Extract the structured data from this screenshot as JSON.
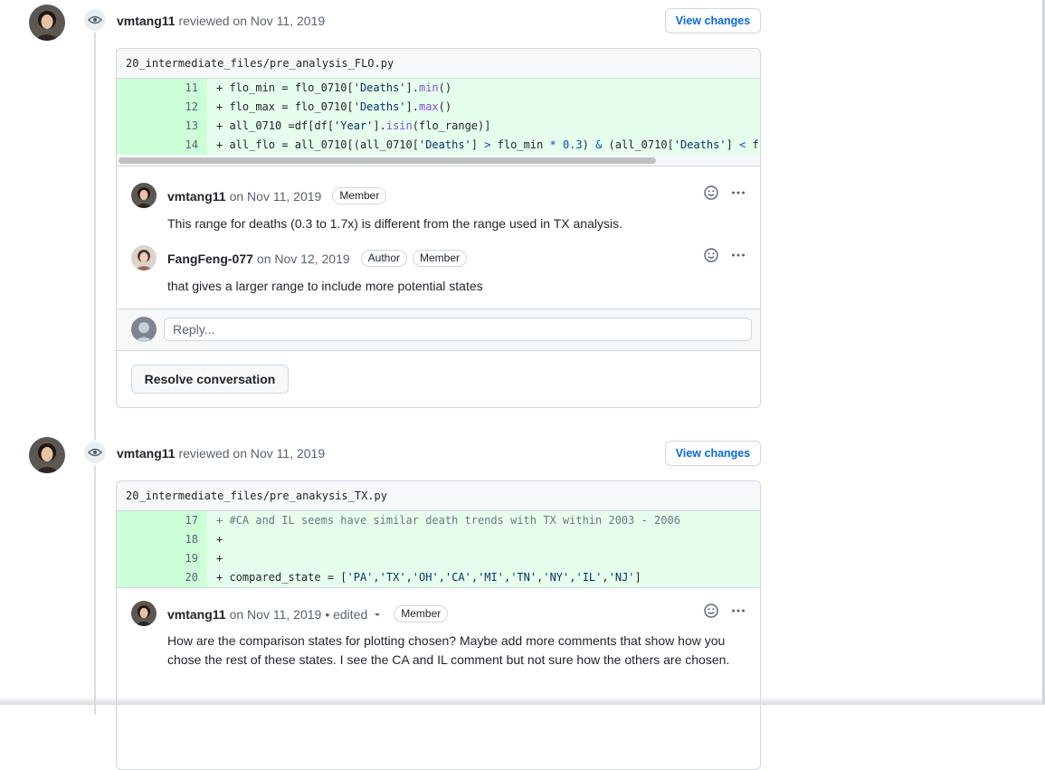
{
  "reviews": [
    {
      "author": "vmtang11",
      "verb": "reviewed",
      "date": "on Nov 11, 2019",
      "view_changes": "View changes",
      "file": "20_intermediate_files/pre_analysis_FLO.py",
      "lines": [
        {
          "num": "11"
        },
        {
          "num": "12"
        },
        {
          "num": "13"
        },
        {
          "num": "14"
        }
      ],
      "comments": [
        {
          "author": "vmtang11",
          "date": "on Nov 11, 2019",
          "labels": [
            "Member"
          ],
          "body": "This range for deaths (0.3 to 1.7x) is different from the range used in TX analysis."
        },
        {
          "author": "FangFeng-077",
          "date": "on Nov 12, 2019",
          "labels": [
            "Author",
            "Member"
          ],
          "body": "that gives a larger range to include more potential states"
        }
      ],
      "reply_placeholder": "Reply...",
      "resolve_label": "Resolve conversation"
    },
    {
      "author": "vmtang11",
      "verb": "reviewed",
      "date": "on Nov 11, 2019",
      "view_changes": "View changes",
      "file": "20_intermediate_files/pre_anakysis_TX.py",
      "lines": [
        {
          "num": "17"
        },
        {
          "num": "18"
        },
        {
          "num": "19"
        },
        {
          "num": "20"
        }
      ],
      "comments": [
        {
          "author": "vmtang11",
          "date": "on Nov 11, 2019",
          "edited": "• edited",
          "labels": [
            "Member"
          ],
          "body": "How are the comparison states for plotting chosen? Maybe add more comments that show how you chose the rest of these states. I see the CA and IL comment but not sure how the others are chosen."
        }
      ]
    }
  ],
  "icons": [
    "eye-icon",
    "smiley-icon",
    "kebab-horizontal-icon",
    "triangle-down-icon"
  ],
  "colors": {
    "addition_bg": "#e6ffec",
    "addition_num_bg": "#ccffd8",
    "link": "#0969da",
    "border": "#d0d7de"
  }
}
